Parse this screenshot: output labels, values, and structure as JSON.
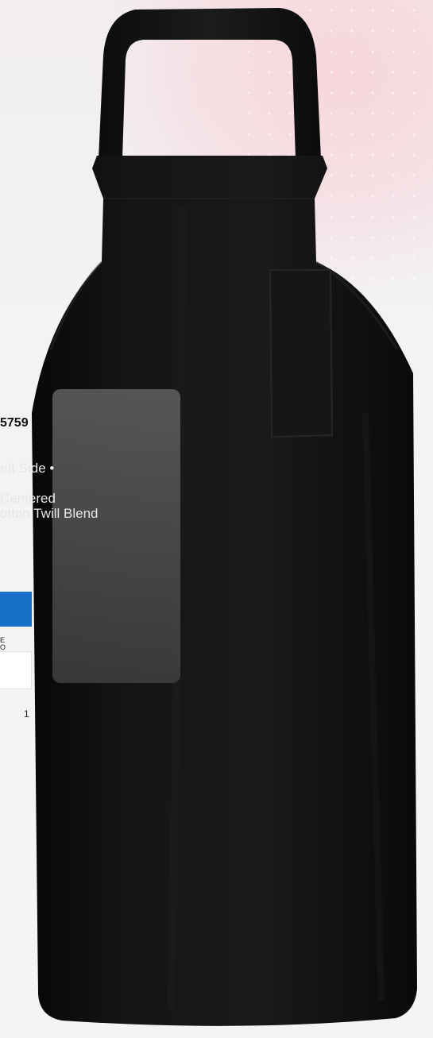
{
  "product": {
    "sku_partial": "5759",
    "description_lines": [
      "eft Side •",
      "",
      "Centered",
      "otton Twill Blend"
    ],
    "detail_label_line1": "E",
    "detail_label_line2": "O",
    "quantity": "1"
  },
  "colors": {
    "apron": "#121212",
    "accent": "#1670c7",
    "overlay": "#6e6e6e",
    "background_tint": "#f7d6db"
  }
}
